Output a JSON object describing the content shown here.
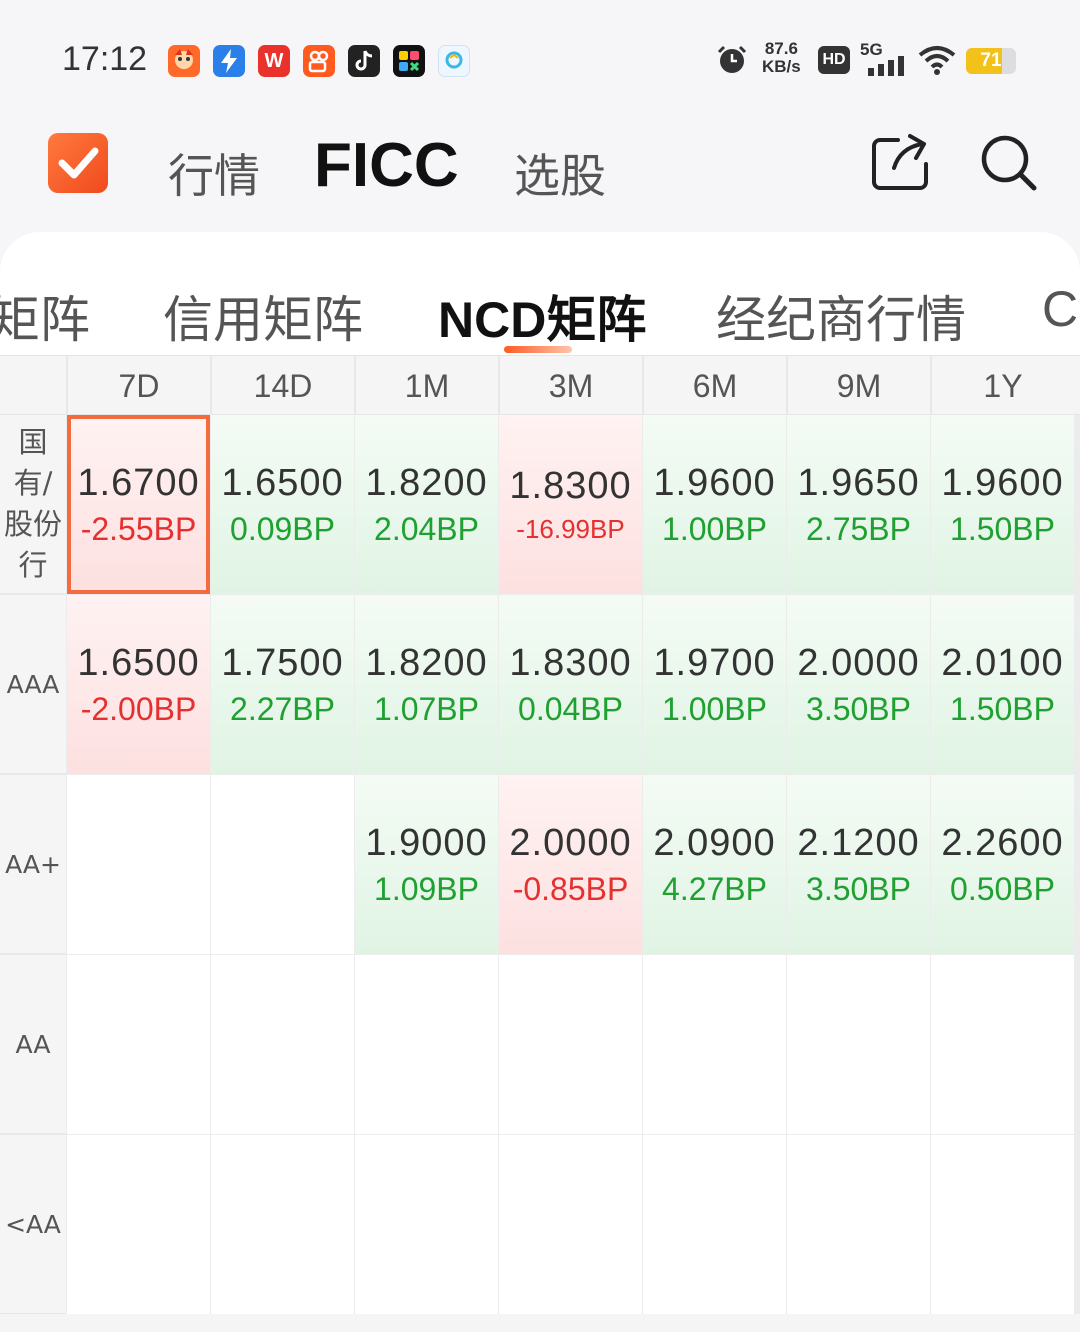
{
  "status_bar": {
    "time": "17:12",
    "net_speed_value": "87.6",
    "net_speed_unit": "KB/s",
    "hd_label": "HD",
    "signal_label": "5G",
    "battery": "71",
    "battery_level": 0.71
  },
  "app_icons": [
    "mascot-app-icon",
    "bolt-app-icon",
    "wps-app-icon",
    "kuaishou-app-icon",
    "douyin-app-icon",
    "grid-app-icon",
    "photo-app-icon"
  ],
  "header": {
    "tabs": [
      {
        "label": "行情",
        "active": false
      },
      {
        "label": "FICC",
        "active": true
      },
      {
        "label": "选股",
        "active": false
      }
    ],
    "icons": [
      "share-icon",
      "search-icon"
    ]
  },
  "subtabs": [
    {
      "label": "矩阵",
      "active": false
    },
    {
      "label": "信用矩阵",
      "active": false
    },
    {
      "label": "NCD矩阵",
      "active": true
    },
    {
      "label": "经纪商行情",
      "active": false
    },
    {
      "label": "CI",
      "active": false
    }
  ],
  "matrix": {
    "columns": [
      "7D",
      "14D",
      "1M",
      "3M",
      "6M",
      "9M",
      "1Y"
    ],
    "rows": [
      {
        "label": "国\n有/\n股份\n行",
        "cells": [
          {
            "rate": "1.6700",
            "change": "-2.55BP",
            "dir": "down",
            "selected": true
          },
          {
            "rate": "1.6500",
            "change": "0.09BP",
            "dir": "up"
          },
          {
            "rate": "1.8200",
            "change": "2.04BP",
            "dir": "up"
          },
          {
            "rate": "1.8300",
            "change": "-16.99BP",
            "dir": "down"
          },
          {
            "rate": "1.9600",
            "change": "1.00BP",
            "dir": "up"
          },
          {
            "rate": "1.9650",
            "change": "2.75BP",
            "dir": "up"
          },
          {
            "rate": "1.9600",
            "change": "1.50BP",
            "dir": "up"
          }
        ]
      },
      {
        "label": "AAA",
        "cells": [
          {
            "rate": "1.6500",
            "change": "-2.00BP",
            "dir": "down"
          },
          {
            "rate": "1.7500",
            "change": "2.27BP",
            "dir": "up"
          },
          {
            "rate": "1.8200",
            "change": "1.07BP",
            "dir": "up"
          },
          {
            "rate": "1.8300",
            "change": "0.04BP",
            "dir": "up"
          },
          {
            "rate": "1.9700",
            "change": "1.00BP",
            "dir": "up"
          },
          {
            "rate": "2.0000",
            "change": "3.50BP",
            "dir": "up"
          },
          {
            "rate": "2.0100",
            "change": "1.50BP",
            "dir": "up"
          }
        ]
      },
      {
        "label": "AA+",
        "cells": [
          {
            "rate": "",
            "change": "",
            "dir": "empty"
          },
          {
            "rate": "",
            "change": "",
            "dir": "empty"
          },
          {
            "rate": "1.9000",
            "change": "1.09BP",
            "dir": "up"
          },
          {
            "rate": "2.0000",
            "change": "-0.85BP",
            "dir": "down"
          },
          {
            "rate": "2.0900",
            "change": "4.27BP",
            "dir": "up"
          },
          {
            "rate": "2.1200",
            "change": "3.50BP",
            "dir": "up"
          },
          {
            "rate": "2.2600",
            "change": "0.50BP",
            "dir": "up"
          }
        ]
      },
      {
        "label": "AA",
        "cells": [
          {
            "rate": "",
            "change": "",
            "dir": "empty"
          },
          {
            "rate": "",
            "change": "",
            "dir": "empty"
          },
          {
            "rate": "",
            "change": "",
            "dir": "empty"
          },
          {
            "rate": "",
            "change": "",
            "dir": "empty"
          },
          {
            "rate": "",
            "change": "",
            "dir": "empty"
          },
          {
            "rate": "",
            "change": "",
            "dir": "empty"
          },
          {
            "rate": "",
            "change": "",
            "dir": "empty"
          }
        ]
      },
      {
        "label": "<AA",
        "cells": [
          {
            "rate": "",
            "change": "",
            "dir": "empty"
          },
          {
            "rate": "",
            "change": "",
            "dir": "empty"
          },
          {
            "rate": "",
            "change": "",
            "dir": "empty"
          },
          {
            "rate": "",
            "change": "",
            "dir": "empty"
          },
          {
            "rate": "",
            "change": "",
            "dir": "empty"
          },
          {
            "rate": "",
            "change": "",
            "dir": "empty"
          },
          {
            "rate": "",
            "change": "",
            "dir": "empty"
          }
        ]
      }
    ]
  },
  "colors": {
    "accent": "#f04a1e",
    "up": "#20a030",
    "down": "#e53030"
  }
}
